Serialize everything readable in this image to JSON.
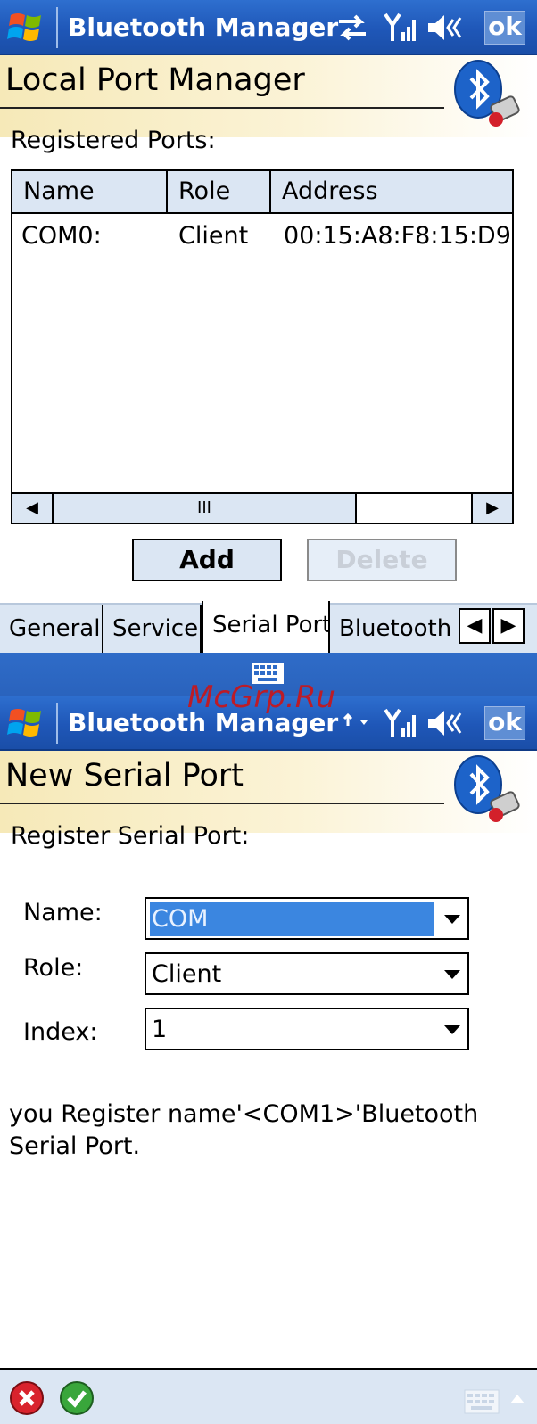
{
  "screen1": {
    "titlebar": {
      "title": "Bluetooth Manager",
      "ok_label": "ok"
    },
    "header": {
      "title": "Local Port Manager"
    },
    "registered_label": "Registered Ports:",
    "list": {
      "columns": [
        "Name",
        "Role",
        "Address"
      ],
      "rows": [
        {
          "name": "COM0:",
          "role": "Client",
          "address": "00:15:A8:F8:15:D9"
        }
      ],
      "scroll_thumb": "III"
    },
    "buttons": {
      "add": "Add",
      "delete": "Delete"
    },
    "tabs": [
      "General",
      "Service",
      "Serial Port",
      "Bluetooth H"
    ],
    "active_tab": "Serial Port"
  },
  "screen2": {
    "titlebar": {
      "title": "Bluetooth Manager",
      "ok_label": "ok"
    },
    "header": {
      "title": "New Serial Port"
    },
    "register_label": "Register Serial Port:",
    "form": {
      "name_label": "Name:",
      "name_value": "COM",
      "role_label": "Role:",
      "role_value": "Client",
      "index_label": "Index:",
      "index_value": "1"
    },
    "description": "you Register  name'<COM1>'Bluetooth Serial Port."
  },
  "watermark": "McGrp.Ru",
  "colors": {
    "titlebar": "#1f57b8",
    "header_gradient": "#f6e9b8",
    "panel": "#dbe6f3",
    "selection": "#3b86e0",
    "watermark": "#c8161b"
  }
}
